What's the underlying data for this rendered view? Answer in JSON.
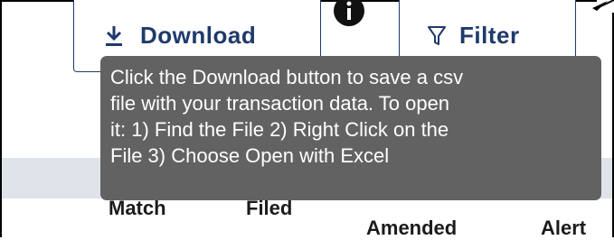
{
  "toolbar": {
    "download_label": "Download",
    "filter_label": "Filter",
    "download_icon": "download-icon",
    "filter_icon": "filter-icon",
    "info_icon": "info-icon"
  },
  "tooltip": {
    "text": "Click the Download button to save a csv\nfile with your transaction data. To open\nit: 1) Find the File 2) Right Click on the\nFile 3) Choose Open with Excel"
  },
  "table": {
    "columns": [
      "Match",
      "Filed",
      "Amended",
      "Alert"
    ]
  },
  "colors": {
    "button_text": "#1f3a6b",
    "tooltip_bg": "#626262",
    "table_bg": "#dfe3ea"
  }
}
